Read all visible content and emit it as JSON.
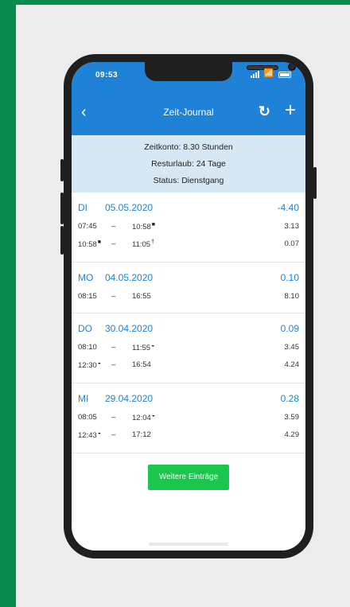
{
  "status_bar": {
    "time": "09:53"
  },
  "nav": {
    "back_icon": "chevron-left-icon",
    "title": "Zeit-Journal",
    "refresh_icon": "refresh-icon",
    "add_icon": "plus-icon"
  },
  "summary": {
    "zeitkonto": "Zeitkonto: 8.30 Stunden",
    "resturlaub": "Resturlaub: 24 Tage",
    "status": "Status: Dienstgang"
  },
  "days": [
    {
      "weekday": "DI",
      "date": "05.05.2020",
      "total": "-4.40",
      "entries": [
        {
          "from": "07:45",
          "to": "10:58",
          "hours": "3.13"
        },
        {
          "from": "10:58",
          "to": "11:05",
          "hours": "0.07"
        }
      ]
    },
    {
      "weekday": "MO",
      "date": "04.05.2020",
      "total": "0.10",
      "entries": [
        {
          "from": "08:15",
          "to": "16:55",
          "hours": "8.10"
        }
      ]
    },
    {
      "weekday": "DO",
      "date": "30.04.2020",
      "total": "0.09",
      "entries": [
        {
          "from": "08:10",
          "to": "11:55",
          "hours": "3.45"
        },
        {
          "from": "12:30",
          "to": "16:54",
          "hours": "4.24"
        }
      ]
    },
    {
      "weekday": "MI",
      "date": "29.04.2020",
      "total": "0.28",
      "entries": [
        {
          "from": "08:05",
          "to": "12:04",
          "hours": "3.59"
        },
        {
          "from": "12:43",
          "to": "17:12",
          "hours": "4.29"
        }
      ]
    }
  ],
  "separator": "–",
  "more_button": "Weitere Einträge",
  "colors": {
    "accent": "#1f82d6",
    "summary_bg": "#d7e7f3",
    "button": "#1cc54e",
    "frame": "#0a8a4e"
  }
}
